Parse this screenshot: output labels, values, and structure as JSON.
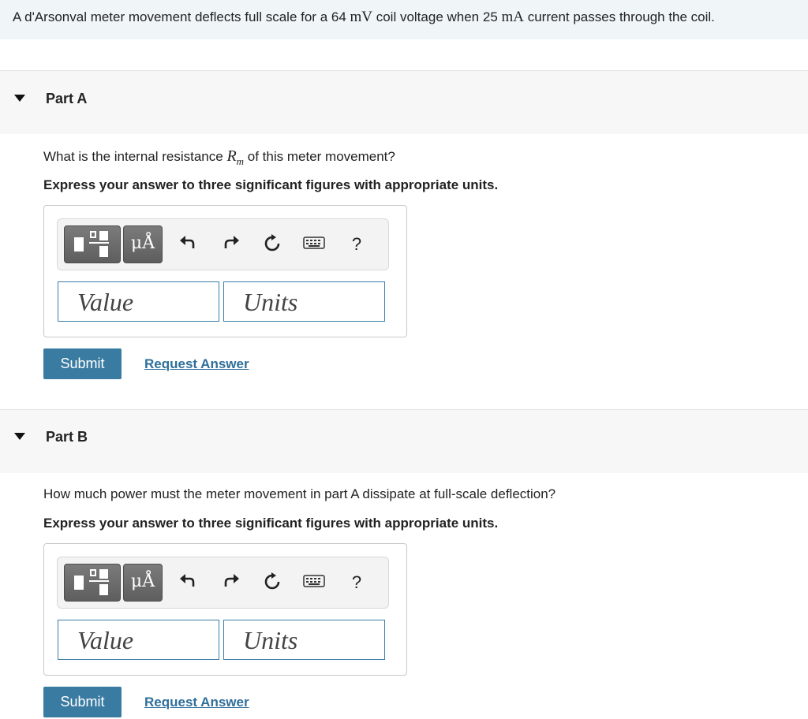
{
  "intro": {
    "t1": "A d'Arsonval meter movement deflects full scale for a 64 ",
    "u1": "mV",
    "t2": " coil voltage when 25 ",
    "u2": "mA",
    "t3": " current passes through the coil."
  },
  "parts": [
    {
      "title": "Part A",
      "question_pre": "What is the internal resistance ",
      "symbol": "R",
      "symbol_sub": "m",
      "question_post": " of this meter movement?",
      "instruction": "Express your answer to three significant figures with appropriate units.",
      "value_placeholder": "Value",
      "units_placeholder": "Units",
      "units_button": "μÅ",
      "help": "?",
      "submit": "Submit",
      "request": "Request Answer"
    },
    {
      "title": "Part B",
      "question": "How much power must the meter movement in part A dissipate at full-scale deflection?",
      "instruction": "Express your answer to three significant figures with appropriate units.",
      "value_placeholder": "Value",
      "units_placeholder": "Units",
      "units_button": "μÅ",
      "help": "?",
      "submit": "Submit",
      "request": "Request Answer"
    }
  ],
  "icons": {
    "templates": "templates-icon",
    "units": "units-icon",
    "undo": "undo-icon",
    "redo": "redo-icon",
    "reset": "reset-icon",
    "keyboard": "keyboard-icon",
    "help": "help-icon"
  },
  "colors": {
    "accent": "#3a7ba2",
    "link": "#2f6f9b",
    "field_border": "#3b7ea8",
    "intro_bg": "#f0f6f8"
  }
}
